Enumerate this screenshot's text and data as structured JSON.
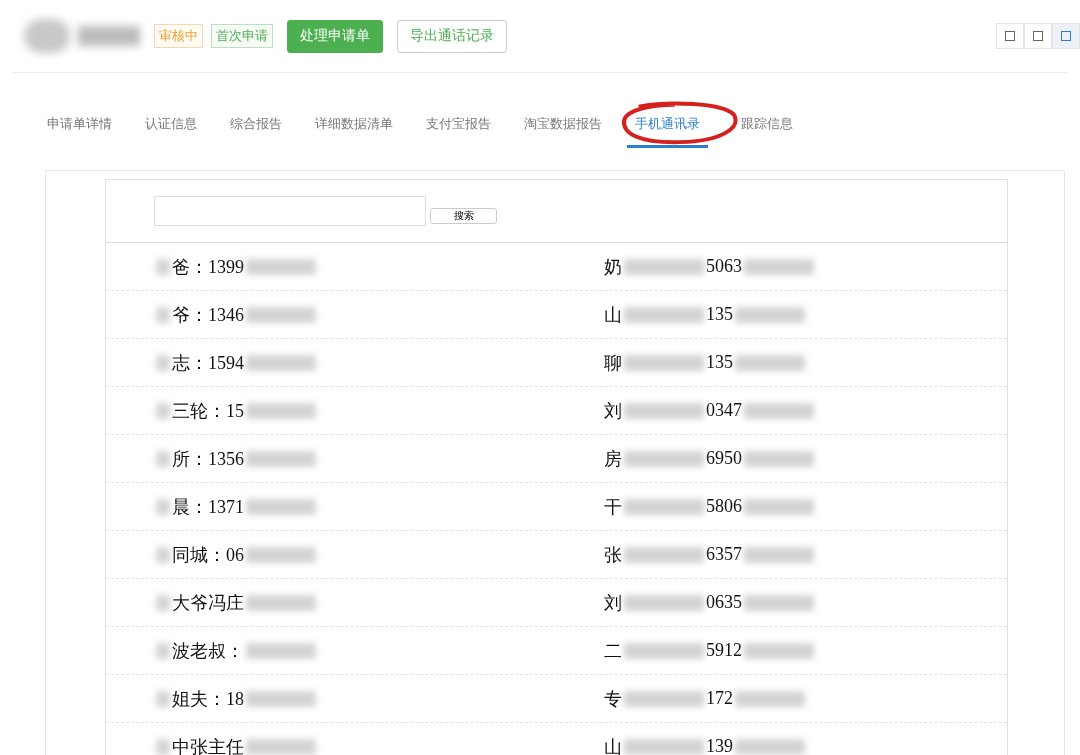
{
  "header": {
    "tags": [
      {
        "label": "审核中",
        "kind": "warning"
      },
      {
        "label": "首次申请",
        "kind": "success"
      }
    ],
    "buttons": [
      {
        "label": "处理申请单",
        "kind": "primary"
      },
      {
        "label": "导出通话记录",
        "kind": "outline"
      }
    ],
    "view_toggles": [
      {
        "selected": false
      },
      {
        "selected": false
      },
      {
        "selected": true
      }
    ]
  },
  "tabs": [
    {
      "label": "申请单详情",
      "selected": false,
      "circled": false
    },
    {
      "label": "认证信息",
      "selected": false,
      "circled": false
    },
    {
      "label": "综合报告",
      "selected": false,
      "circled": false
    },
    {
      "label": "详细数据清单",
      "selected": false,
      "circled": false
    },
    {
      "label": "支付宝报告",
      "selected": false,
      "circled": false
    },
    {
      "label": "淘宝数据报告",
      "selected": false,
      "circled": false
    },
    {
      "label": "手机通讯录",
      "selected": true,
      "circled": true
    },
    {
      "label": "跟踪信息",
      "selected": false,
      "circled": false
    }
  ],
  "search": {
    "button": "搜索"
  },
  "contacts": [
    {
      "left": [
        {
          "kind": "blur"
        },
        {
          "kind": "text",
          "text": "爸：1399"
        },
        {
          "kind": "blur"
        }
      ],
      "right": [
        {
          "kind": "text",
          "text": "奶"
        },
        {
          "kind": "blur"
        },
        {
          "kind": "text",
          "text": "5063"
        },
        {
          "kind": "blur"
        }
      ]
    },
    {
      "left": [
        {
          "kind": "blur"
        },
        {
          "kind": "text",
          "text": "爷：1346"
        },
        {
          "kind": "blur"
        }
      ],
      "right": [
        {
          "kind": "text",
          "text": "山"
        },
        {
          "kind": "blur"
        },
        {
          "kind": "text",
          "text": "135"
        },
        {
          "kind": "blur"
        }
      ]
    },
    {
      "left": [
        {
          "kind": "blur"
        },
        {
          "kind": "text",
          "text": "志：1594"
        },
        {
          "kind": "blur"
        }
      ],
      "right": [
        {
          "kind": "text",
          "text": "聊"
        },
        {
          "kind": "blur"
        },
        {
          "kind": "text",
          "text": "135"
        },
        {
          "kind": "blur"
        }
      ]
    },
    {
      "left": [
        {
          "kind": "blur"
        },
        {
          "kind": "text",
          "text": "三轮：15"
        },
        {
          "kind": "blur"
        }
      ],
      "right": [
        {
          "kind": "text",
          "text": "刘"
        },
        {
          "kind": "blur"
        },
        {
          "kind": "text",
          "text": "0347"
        },
        {
          "kind": "blur"
        }
      ]
    },
    {
      "left": [
        {
          "kind": "blur"
        },
        {
          "kind": "text",
          "text": "所：1356"
        },
        {
          "kind": "blur"
        }
      ],
      "right": [
        {
          "kind": "text",
          "text": "房"
        },
        {
          "kind": "blur"
        },
        {
          "kind": "text",
          "text": "6950"
        },
        {
          "kind": "blur"
        }
      ]
    },
    {
      "left": [
        {
          "kind": "blur"
        },
        {
          "kind": "text",
          "text": "晨：1371"
        },
        {
          "kind": "blur"
        }
      ],
      "right": [
        {
          "kind": "text",
          "text": "干"
        },
        {
          "kind": "blur"
        },
        {
          "kind": "text",
          "text": "5806"
        },
        {
          "kind": "blur"
        }
      ]
    },
    {
      "left": [
        {
          "kind": "blur"
        },
        {
          "kind": "text",
          "text": "同城：06"
        },
        {
          "kind": "blur"
        }
      ],
      "right": [
        {
          "kind": "text",
          "text": "张"
        },
        {
          "kind": "blur"
        },
        {
          "kind": "text",
          "text": "6357"
        },
        {
          "kind": "blur"
        }
      ]
    },
    {
      "left": [
        {
          "kind": "blur"
        },
        {
          "kind": "text",
          "text": "大爷冯庄"
        },
        {
          "kind": "blur"
        }
      ],
      "right": [
        {
          "kind": "text",
          "text": "刘"
        },
        {
          "kind": "blur"
        },
        {
          "kind": "text",
          "text": "0635"
        },
        {
          "kind": "blur"
        }
      ]
    },
    {
      "left": [
        {
          "kind": "blur"
        },
        {
          "kind": "text",
          "text": "波老叔："
        },
        {
          "kind": "blur"
        }
      ],
      "right": [
        {
          "kind": "text",
          "text": "二"
        },
        {
          "kind": "blur"
        },
        {
          "kind": "text",
          "text": "5912"
        },
        {
          "kind": "blur"
        }
      ]
    },
    {
      "left": [
        {
          "kind": "blur"
        },
        {
          "kind": "text",
          "text": "姐夫：18"
        },
        {
          "kind": "blur"
        }
      ],
      "right": [
        {
          "kind": "text",
          "text": "专"
        },
        {
          "kind": "blur"
        },
        {
          "kind": "text",
          "text": "172"
        },
        {
          "kind": "blur"
        }
      ]
    },
    {
      "left": [
        {
          "kind": "blur"
        },
        {
          "kind": "text",
          "text": "中张主任"
        },
        {
          "kind": "blur"
        }
      ],
      "right": [
        {
          "kind": "text",
          "text": "山"
        },
        {
          "kind": "blur"
        },
        {
          "kind": "text",
          "text": "139"
        },
        {
          "kind": "blur"
        }
      ]
    }
  ]
}
